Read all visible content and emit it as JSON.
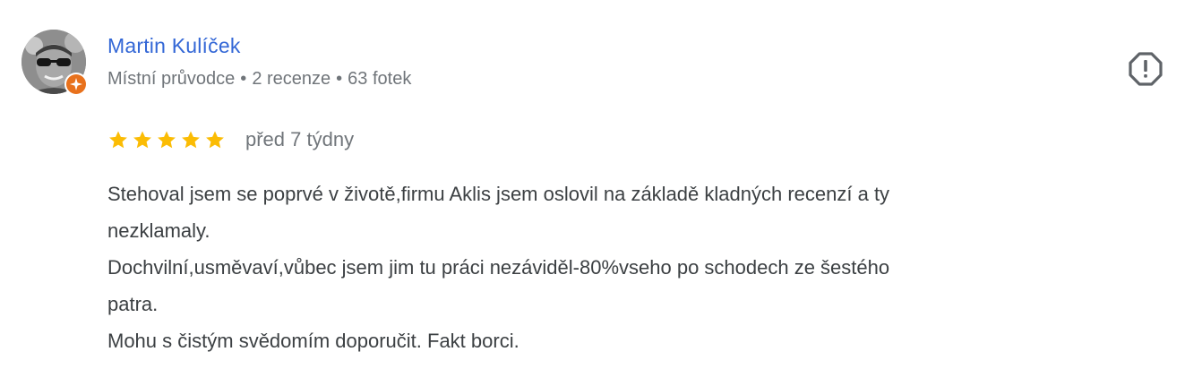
{
  "reviewer": {
    "name": "Martin Kulíček",
    "badge": "Místní průvodce",
    "reviews_count": "2 recenze",
    "photos_count": "63 fotek",
    "separator": "•"
  },
  "review": {
    "rating": 5,
    "rating_max": 5,
    "date": "před 7 týdny",
    "text_lines": [
      "Stehoval jsem se poprvé v životě,firmu Aklis jsem oslovil na základě kladných recenzí a ty",
      "nezklamaly.",
      "Dochvilní,usměvaví,vůbec jsem jim tu práci nezáviděl-80%vseho po schodech ze šestého",
      "patra.",
      "Mohu s čistým svědomím doporučit. Fakt borci."
    ]
  },
  "icons": {
    "report": "report-icon",
    "local_guide": "local-guide-badge-icon",
    "star": "star-icon"
  },
  "colors": {
    "name": "#3367d6",
    "meta": "#70757a",
    "star": "#fbbc04",
    "badge": "#e8711c",
    "text": "#3c4043"
  }
}
